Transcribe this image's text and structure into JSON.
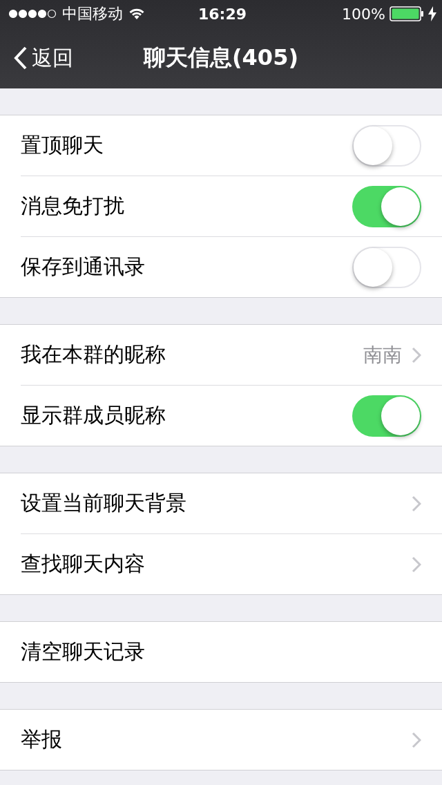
{
  "status_bar": {
    "carrier": "中国移动",
    "time": "16:29",
    "battery": "100%"
  },
  "nav": {
    "back": "返回",
    "title": "聊天信息(405)"
  },
  "groups": [
    {
      "rows": [
        {
          "kind": "switch",
          "label": "置顶聊天",
          "on": false
        },
        {
          "kind": "switch",
          "label": "消息免打扰",
          "on": true
        },
        {
          "kind": "switch",
          "label": "保存到通讯录",
          "on": false
        }
      ]
    },
    {
      "rows": [
        {
          "kind": "value",
          "label": "我在本群的昵称",
          "value": "南南"
        },
        {
          "kind": "switch",
          "label": "显示群成员昵称",
          "on": true
        }
      ]
    },
    {
      "rows": [
        {
          "kind": "link",
          "label": "设置当前聊天背景"
        },
        {
          "kind": "link",
          "label": "查找聊天内容"
        }
      ]
    },
    {
      "rows": [
        {
          "kind": "plain",
          "label": "清空聊天记录"
        }
      ]
    },
    {
      "rows": [
        {
          "kind": "link",
          "label": "举报"
        }
      ]
    }
  ]
}
